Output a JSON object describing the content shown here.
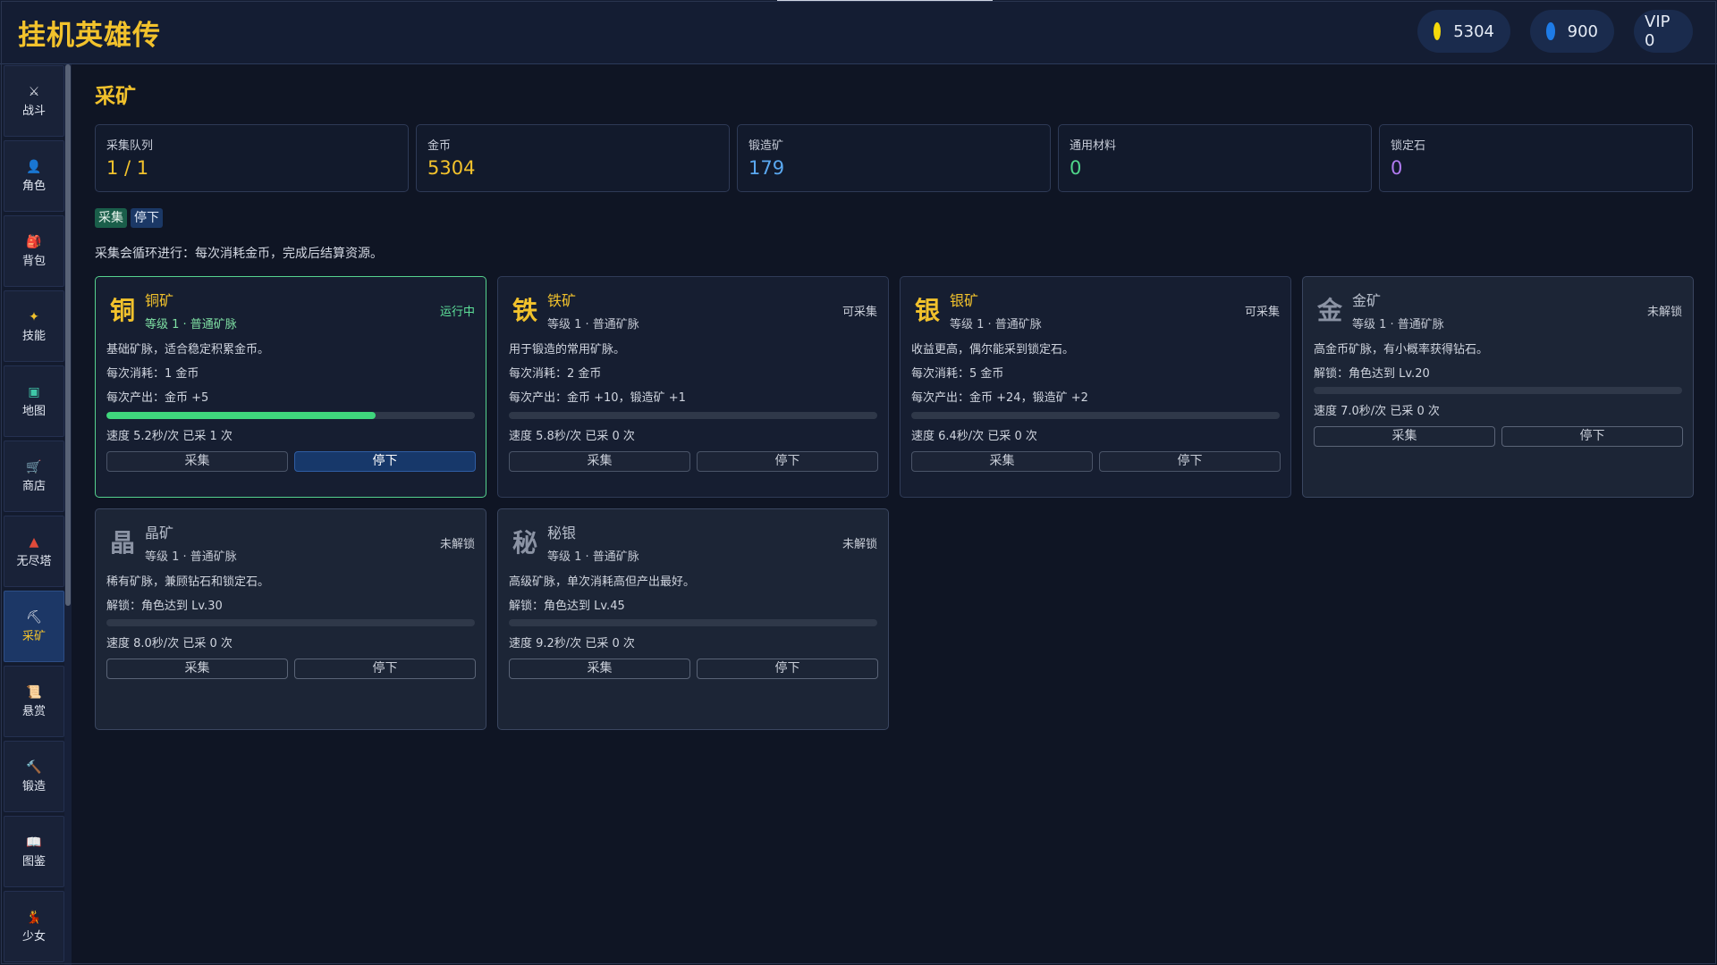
{
  "app": {
    "title": "挂机英雄传"
  },
  "header": {
    "gold": {
      "value": "5304",
      "color": "#f5d90a"
    },
    "gem": {
      "value": "900",
      "color": "#1e7be6"
    },
    "vip": "VIP 0"
  },
  "sidebar": {
    "items": [
      {
        "label": "战斗",
        "icon": "crossed-swords-icon",
        "glyph": "⚔",
        "color": "#e0e4ec"
      },
      {
        "label": "角色",
        "icon": "person-icon",
        "glyph": "👤",
        "color": "#c9ced8"
      },
      {
        "label": "背包",
        "icon": "backpack-icon",
        "glyph": "🎒",
        "color": "#e04a3a"
      },
      {
        "label": "技能",
        "icon": "sparkle-icon",
        "glyph": "✦",
        "color": "#f2c22c"
      },
      {
        "label": "地图",
        "icon": "map-icon",
        "glyph": "▣",
        "color": "#3fc7a8"
      },
      {
        "label": "商店",
        "icon": "cart-icon",
        "glyph": "🛒",
        "color": "#c9ced8"
      },
      {
        "label": "无尽塔",
        "icon": "tower-icon",
        "glyph": "▲",
        "color": "#e04a3a"
      },
      {
        "label": "采矿",
        "icon": "pickaxe-icon",
        "glyph": "⛏",
        "color": "#e0e4ec"
      },
      {
        "label": "悬赏",
        "icon": "scroll-icon",
        "glyph": "📜",
        "color": "#e6dcc4"
      },
      {
        "label": "锻造",
        "icon": "hammer-icon",
        "glyph": "🔨",
        "color": "#e0a84a"
      },
      {
        "label": "图鉴",
        "icon": "book-icon",
        "glyph": "📖",
        "color": "#e0e4ec"
      },
      {
        "label": "少女",
        "icon": "girl-icon",
        "glyph": "💃",
        "color": "#e04a3a"
      }
    ],
    "active_index": 7
  },
  "page": {
    "title": "采矿",
    "stats": [
      {
        "label": "采集队列",
        "value": "1 / 1",
        "color": "#f2c22c"
      },
      {
        "label": "金币",
        "value": "5304",
        "color": "#f2c22c"
      },
      {
        "label": "锻造矿",
        "value": "179",
        "color": "#5aa8f0"
      },
      {
        "label": "通用材料",
        "value": "0",
        "color": "#4fd68a"
      },
      {
        "label": "锁定石",
        "value": "0",
        "color": "#b07af0"
      }
    ],
    "tags": {
      "collect": "采集",
      "stop": "停下"
    },
    "info": "采集会循环进行：每次消耗金币，完成后结算资源。"
  },
  "mines": [
    {
      "glyph": "铜",
      "name": "铜矿",
      "level": "等级 1 · 普通矿脉",
      "status": "运行中",
      "state": "running",
      "desc": "基础矿脉，适合稳定积累金币。",
      "cost": "每次消耗：1 金币",
      "output": "每次产出：金币 +5",
      "progress": 0.73,
      "speed": "速度 5.2秒/次  已采 1 次",
      "btn_collect": "采集",
      "btn_stop": "停下"
    },
    {
      "glyph": "铁",
      "name": "铁矿",
      "level": "等级 1 · 普通矿脉",
      "status": "可采集",
      "state": "available",
      "desc": "用于锻造的常用矿脉。",
      "cost": "每次消耗：2 金币",
      "output": "每次产出：金币 +10，锻造矿 +1",
      "progress": 0,
      "speed": "速度 5.8秒/次  已采 0 次",
      "btn_collect": "采集",
      "btn_stop": "停下"
    },
    {
      "glyph": "银",
      "name": "银矿",
      "level": "等级 1 · 普通矿脉",
      "status": "可采集",
      "state": "available",
      "desc": "收益更高，偶尔能采到锁定石。",
      "cost": "每次消耗：5 金币",
      "output": "每次产出：金币 +24，锻造矿 +2",
      "progress": 0,
      "speed": "速度 6.4秒/次  已采 0 次",
      "btn_collect": "采集",
      "btn_stop": "停下"
    },
    {
      "glyph": "金",
      "name": "金矿",
      "level": "等级 1 · 普通矿脉",
      "status": "未解锁",
      "state": "locked",
      "desc": "高金币矿脉，有小概率获得钻石。",
      "unlock": "解锁：角色达到 Lv.20",
      "progress": 0,
      "speed": "速度 7.0秒/次  已采 0 次",
      "btn_collect": "采集",
      "btn_stop": "停下"
    },
    {
      "glyph": "晶",
      "name": "晶矿",
      "level": "等级 1 · 普通矿脉",
      "status": "未解锁",
      "state": "locked",
      "desc": "稀有矿脉，兼顾钻石和锁定石。",
      "unlock": "解锁：角色达到 Lv.30",
      "progress": 0,
      "speed": "速度 8.0秒/次  已采 0 次",
      "btn_collect": "采集",
      "btn_stop": "停下"
    },
    {
      "glyph": "秘",
      "name": "秘银",
      "level": "等级 1 · 普通矿脉",
      "status": "未解锁",
      "state": "locked",
      "desc": "高级矿脉，单次消耗高但产出最好。",
      "unlock": "解锁：角色达到 Lv.45",
      "progress": 0,
      "speed": "速度 9.2秒/次  已采 0 次",
      "btn_collect": "采集",
      "btn_stop": "停下"
    }
  ]
}
